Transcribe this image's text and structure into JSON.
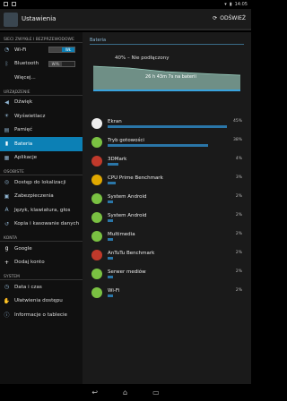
{
  "status": {
    "time": "14:05"
  },
  "app": {
    "title": "Ustawienia",
    "refresh_label": "ODŚWIEŻ"
  },
  "sidebar": {
    "sections": {
      "network": "SIECI ZWYKŁE I BEZPRZEWODOWE",
      "device": "URZĄDZENIE",
      "personal": "OSOBISTE",
      "accounts": "KONTA",
      "system": "SYSTEM"
    },
    "wifi": {
      "label": "Wi-Fi",
      "toggle": "WŁ"
    },
    "bluetooth": {
      "label": "Bluetooth",
      "toggle": "WYŁ"
    },
    "more": "Więcej...",
    "items_device": [
      "Dźwięk",
      "Wyświetlacz",
      "Pamięć",
      "Bateria",
      "Aplikacje"
    ],
    "items_personal": [
      "Dostęp do lokalizacji",
      "Zabezpieczenia",
      "Język, klawiatura, głos",
      "Kopia i kasowanie danych"
    ],
    "items_accounts": [
      "Google",
      "Dodaj konto"
    ],
    "items_system": [
      "Data i czas",
      "Ułatwienia dostępu",
      "Informacje o tablecie"
    ]
  },
  "main": {
    "header": "Bateria",
    "status_text": "40% – Nie podłączony",
    "graph_text": "26 h 43m 7s na baterii",
    "rows": [
      {
        "name": "Ekran",
        "pct": "45%",
        "fill": 0.45
      },
      {
        "name": "Tryb gotowości",
        "pct": "38%",
        "fill": 0.38
      },
      {
        "name": "3DMark",
        "pct": "4%",
        "fill": 0.04
      },
      {
        "name": "CPU Prime Benchmark",
        "pct": "3%",
        "fill": 0.03
      },
      {
        "name": "System Android",
        "pct": "2%",
        "fill": 0.02
      },
      {
        "name": "System Android",
        "pct": "2%",
        "fill": 0.02
      },
      {
        "name": "Multimedia",
        "pct": "2%",
        "fill": 0.02
      },
      {
        "name": "AnTuTu Benchmark",
        "pct": "2%",
        "fill": 0.02
      },
      {
        "name": "Serwer mediów",
        "pct": "2%",
        "fill": 0.02
      },
      {
        "name": "Wi-Fi",
        "pct": "2%",
        "fill": 0.02
      }
    ]
  },
  "icons": {
    "back": "back-icon",
    "home": "home-icon",
    "recents": "recents-icon"
  }
}
